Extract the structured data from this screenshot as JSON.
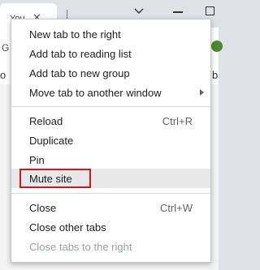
{
  "tab": {
    "title": "You",
    "close_glyph": "✕"
  },
  "window_controls": {
    "chevron": "chevron-down-icon",
    "minimize": "minimize-icon",
    "maximize": "maximize-icon"
  },
  "toolbar": {
    "left_fragment": "G",
    "profile_color": "#4b8a2d"
  },
  "bookmarks": {
    "left_fragment": "o",
    "right_fragment": "b"
  },
  "menu": {
    "group1": [
      {
        "label": "New tab to the right",
        "shortcut": ""
      },
      {
        "label": "Add tab to reading list",
        "shortcut": ""
      },
      {
        "label": "Add tab to new group",
        "shortcut": ""
      },
      {
        "label": "Move tab to another window",
        "shortcut": ""
      }
    ],
    "group2": [
      {
        "label": "Reload",
        "shortcut": "Ctrl+R"
      },
      {
        "label": "Duplicate",
        "shortcut": ""
      },
      {
        "label": "Pin",
        "shortcut": ""
      },
      {
        "label": "Mute site",
        "shortcut": ""
      }
    ],
    "group3": [
      {
        "label": "Close",
        "shortcut": "Ctrl+W"
      },
      {
        "label": "Close other tabs",
        "shortcut": ""
      },
      {
        "label": "Close tabs to the right",
        "shortcut": ""
      }
    ],
    "highlight_color": "#d1161c"
  }
}
